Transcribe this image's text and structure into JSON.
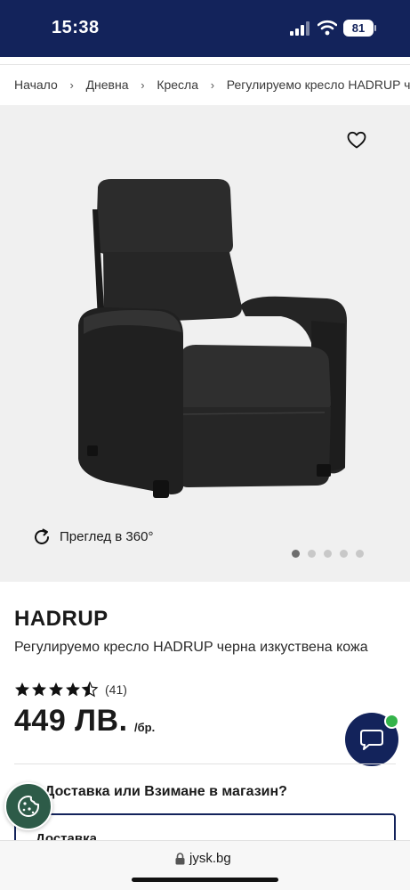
{
  "status_bar": {
    "time": "15:38",
    "battery": "81"
  },
  "breadcrumb": [
    {
      "label": "Начало"
    },
    {
      "label": "Дневна"
    },
    {
      "label": "Кресла"
    },
    {
      "label": "Регулируемо кресло HADRUP черна изкуствена кожа"
    }
  ],
  "gallery": {
    "view360_label": "Преглед в 360°",
    "slide_count": 5,
    "active_slide": 1
  },
  "product": {
    "brand": "HADRUP",
    "name": "Регулируемо кресло HADRUP черна изкуствена кожа",
    "rating": 4.5,
    "rating_count": "(41)",
    "price": "449 ЛВ.",
    "price_unit": "/бр."
  },
  "delivery": {
    "title": "Доставка или Взимане в магазин?",
    "option_label": "Доставка"
  },
  "browser": {
    "url": "jysk.bg"
  },
  "colors": {
    "brand_navy": "#13235b",
    "online_green": "#34b34a",
    "cookie_green": "#2d5b48"
  },
  "icons": [
    "signal-icon",
    "wifi-icon",
    "heart-icon",
    "rotate-360-icon",
    "star-icon",
    "chat-icon",
    "cookie-icon",
    "lock-icon"
  ]
}
